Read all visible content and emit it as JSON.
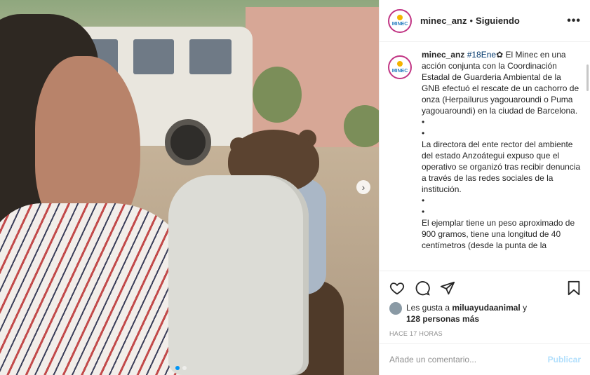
{
  "post": {
    "next_icon": "chevron-right-icon",
    "carousel_count": 2,
    "carousel_active": 0
  },
  "header": {
    "username": "minec_anz",
    "separator": "•",
    "follow_status": "Siguiendo",
    "more_icon": "ellipsis-icon",
    "more_label": "•••",
    "avatar_text": "MINEC"
  },
  "caption": {
    "username": "minec_anz",
    "hashtag": "#18Ene",
    "emoji": "✿",
    "lines": [
      "El Minec en una acción conjunta con la Coordinación Estadal de Guarderia Ambiental de la GNB efectuó el rescate de un cachorro de onza (Herpailurus yagouaroundi o Puma yagouaroundi) en la ciudad de Barcelona.",
      "•",
      "•",
      "La directora del ente rector del ambiente del estado Anzoátegui expuso que el operativo se organizó tras recibir denuncia a través de las redes sociales de la institución.",
      "•",
      "•",
      "El ejemplar tiene un peso aproximado de 900 gramos, tiene una longitud de 40 centímetros (desde la punta de la"
    ]
  },
  "actions": {
    "like_icon": "heart-icon",
    "comment_icon": "comment-icon",
    "share_icon": "paper-plane-icon",
    "save_icon": "bookmark-icon"
  },
  "likes": {
    "prefix": "Les gusta a ",
    "user": "miluayudaanimal",
    "middle": " y ",
    "others": "128 personas más"
  },
  "timestamp": "HACE 17 HORAS",
  "comment": {
    "placeholder": "Añade un comentario...",
    "publish_label": "Publicar"
  },
  "colors": {
    "accent": "#0095f6",
    "publish_disabled": "#b2dffc",
    "hashtag": "#00376b"
  }
}
